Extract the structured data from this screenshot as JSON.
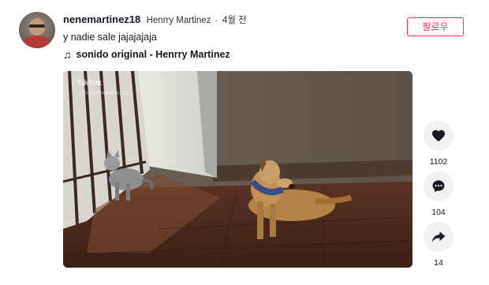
{
  "post": {
    "username": "nenemartinez18",
    "nickname": "Henrry Martinez",
    "separator": "·",
    "date": "4월 전",
    "caption": "y nadie sale jajajajaja",
    "music": "sonido original - Henrry Martinez",
    "follow_label": "팔로우"
  },
  "video": {
    "watermark_brand": "TikTok",
    "watermark_handle": "@nenemartinez18"
  },
  "actions": {
    "likes": "1102",
    "comments": "104",
    "shares": "14"
  },
  "colors": {
    "accent": "#fe2c55",
    "action_bg": "#f1f1f2",
    "text": "#161823"
  },
  "icons": {
    "music": "music-note-icon",
    "like": "heart-icon",
    "comment": "comment-icon",
    "share": "share-icon",
    "watermark": "tiktok-logo-icon"
  }
}
